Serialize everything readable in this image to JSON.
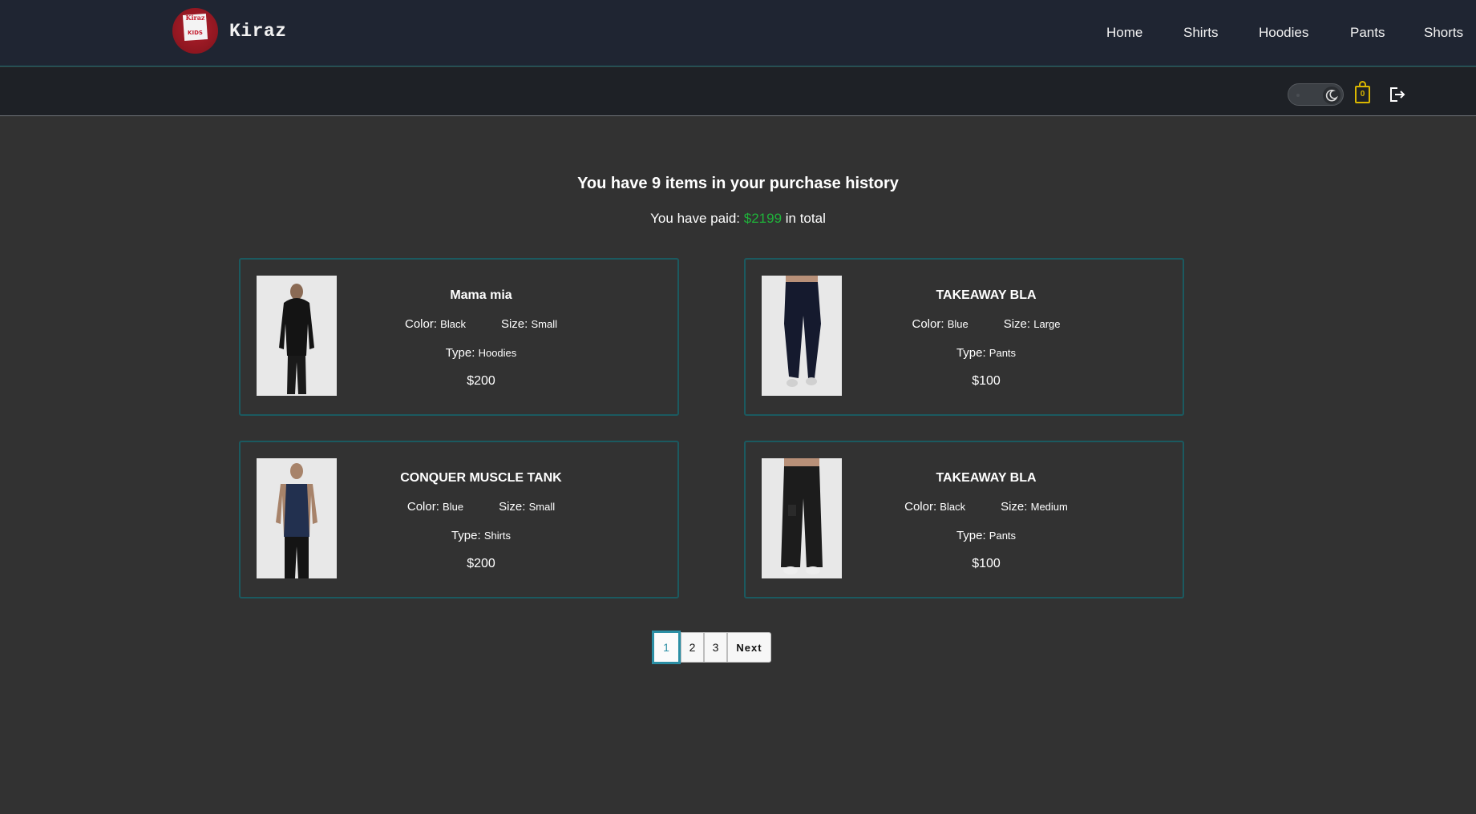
{
  "brand": {
    "name": "Kiraz",
    "logo_text_top": "Kiraz",
    "logo_text_bottom": "KIDS"
  },
  "nav": {
    "items": [
      "Home",
      "Shirts",
      "Hoodies",
      "Pants",
      "Shorts"
    ]
  },
  "toolbar": {
    "cart_count": "0",
    "theme": "dark"
  },
  "summary": {
    "heading": "You have 9 items in your purchase history",
    "paid_prefix": "You have paid: ",
    "paid_amount": "$2199",
    "paid_suffix": " in total"
  },
  "labels": {
    "color": "Color:",
    "size": "Size:",
    "type": "Type:"
  },
  "items": [
    {
      "name": "Mama mia",
      "color": "Black",
      "size": "Small",
      "type": "Hoodies",
      "price": "$200"
    },
    {
      "name": "TAKEAWAY BLA",
      "color": "Blue",
      "size": "Large",
      "type": "Pants",
      "price": "$100"
    },
    {
      "name": "CONQUER MUSCLE TANK",
      "color": "Blue",
      "size": "Small",
      "type": "Shirts",
      "price": "$200"
    },
    {
      "name": "TAKEAWAY BLA",
      "color": "Black",
      "size": "Medium",
      "type": "Pants",
      "price": "$100"
    }
  ],
  "pagination": {
    "pages": [
      "1",
      "2",
      "3"
    ],
    "current": "1",
    "next_label": "Next"
  },
  "colors": {
    "accent": "#2b8fa5",
    "money": "#1fb33a",
    "cart": "#d9b600",
    "card_border": "#1b5a60"
  }
}
